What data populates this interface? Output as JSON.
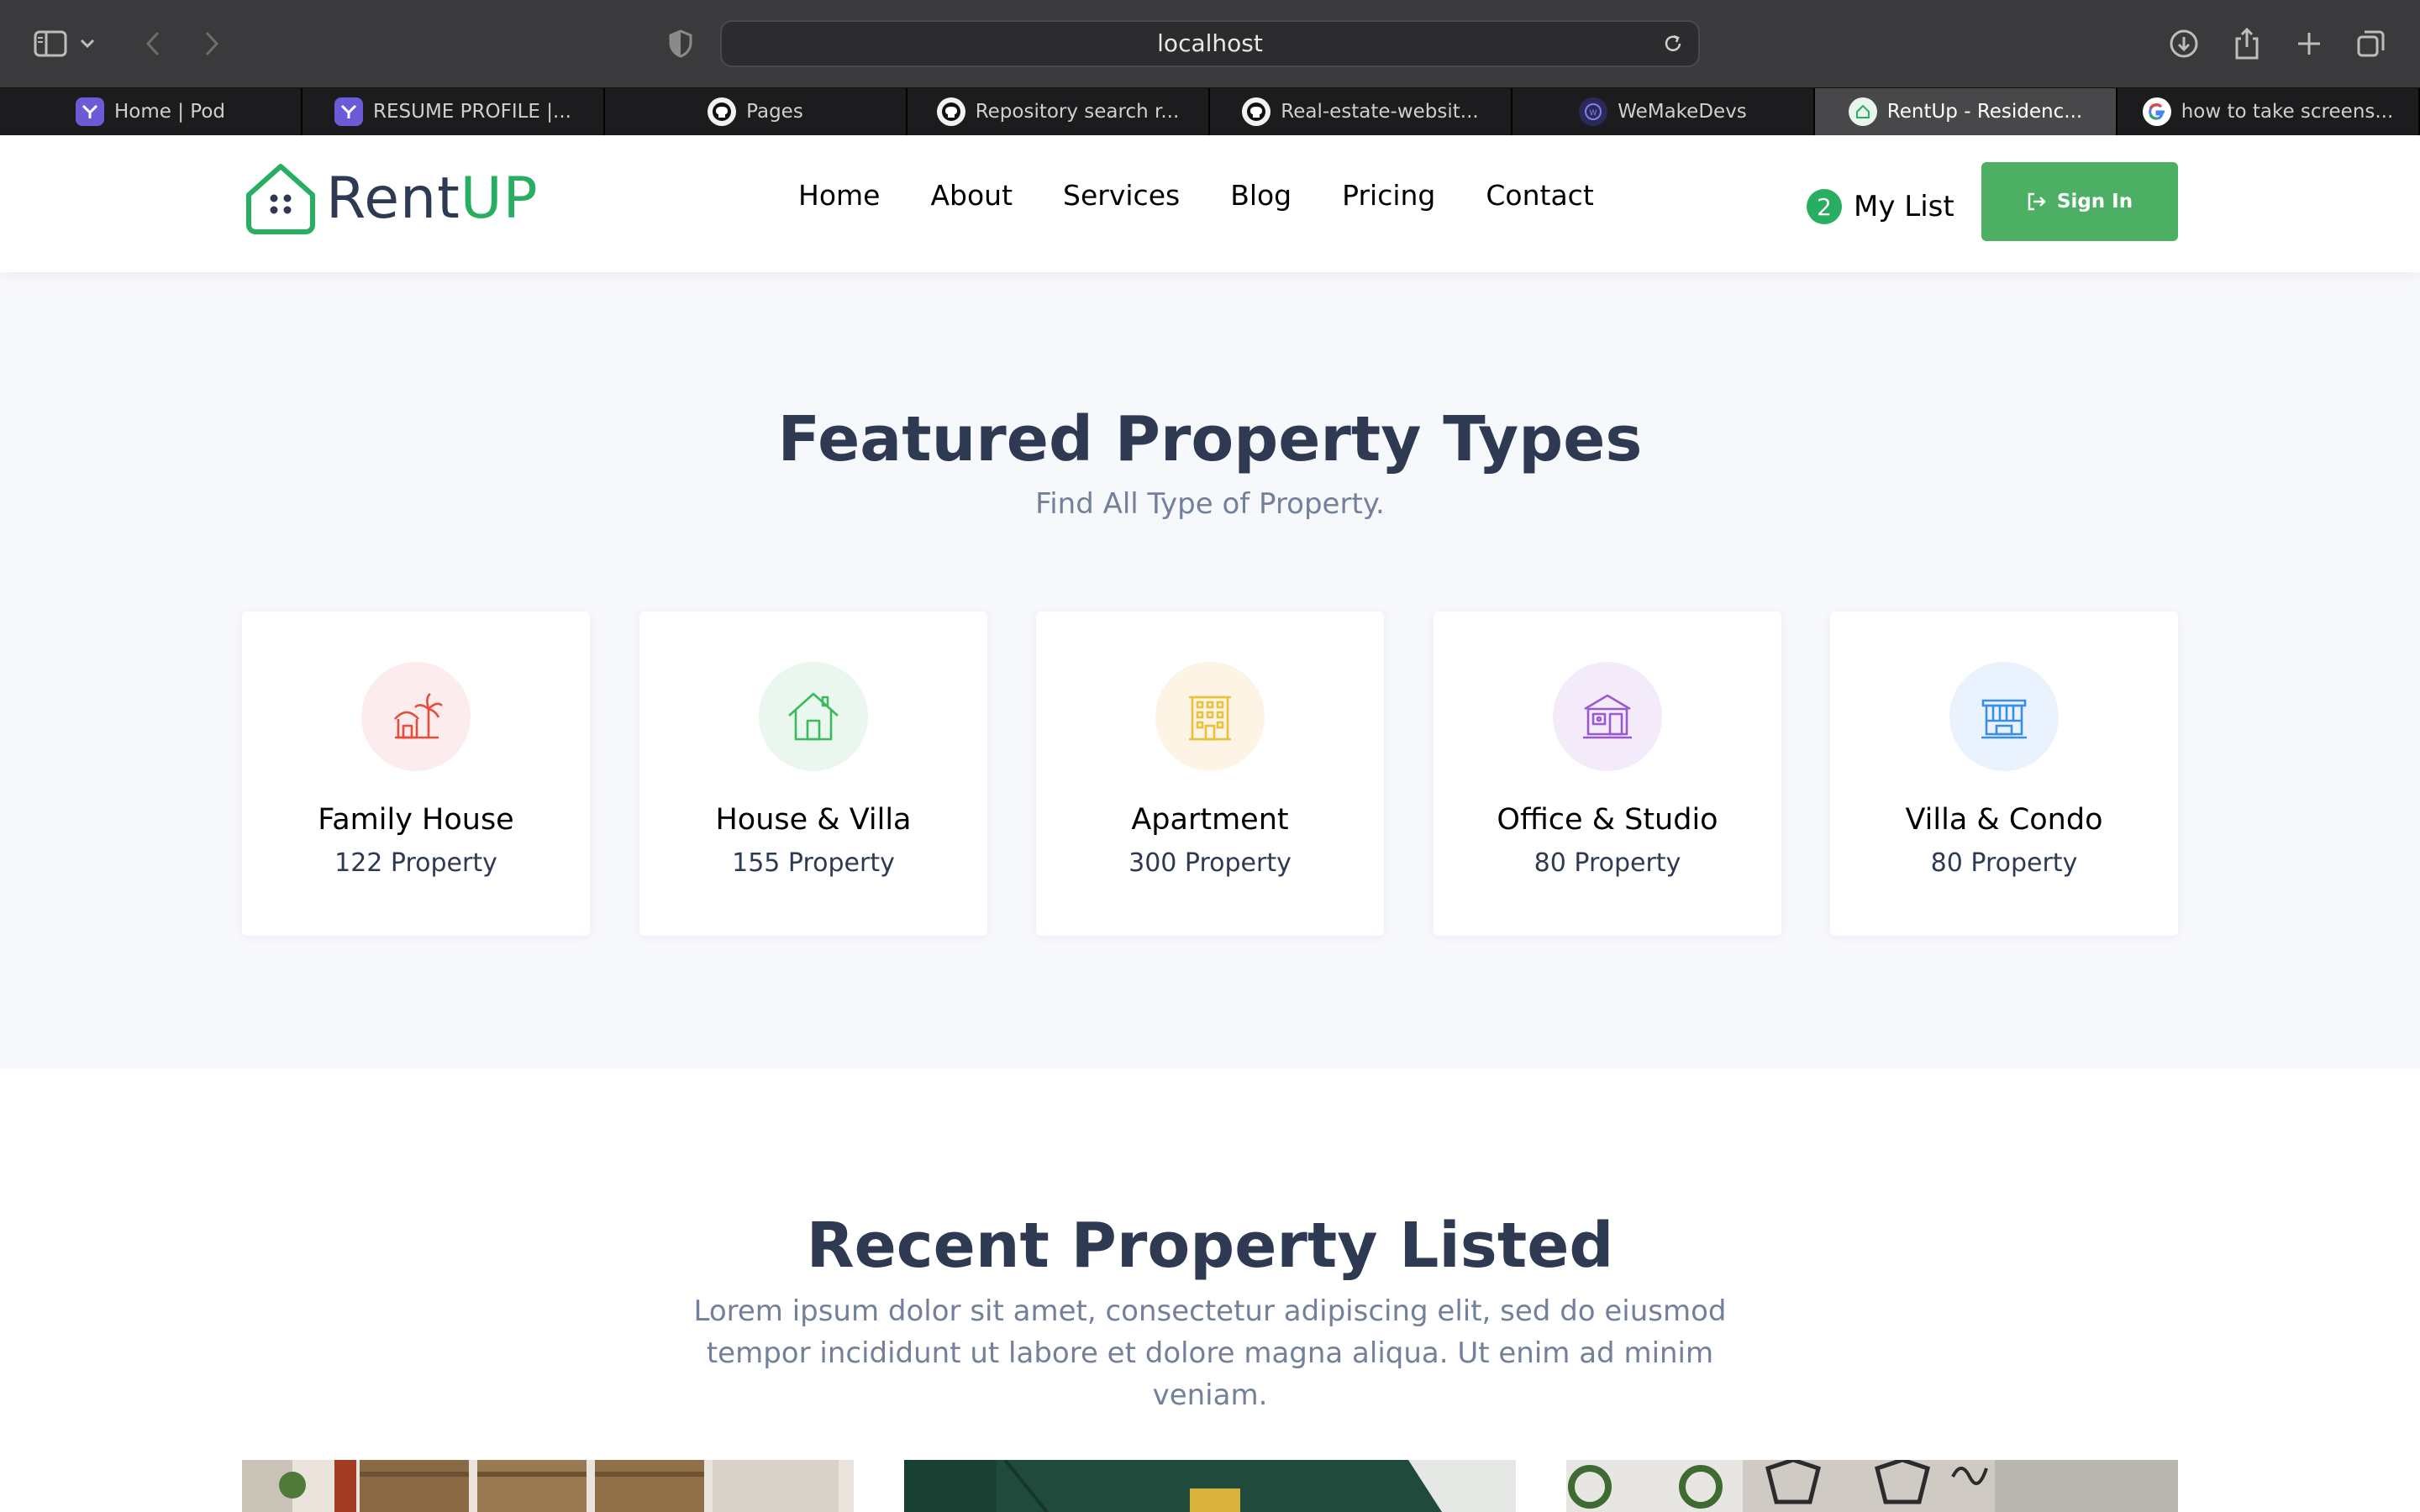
{
  "browser": {
    "url": "localhost",
    "tabs": [
      {
        "title": "Home | Pod",
        "favicon": "pod-icon"
      },
      {
        "title": "RESUME PROFILE |...",
        "favicon": "pod-icon"
      },
      {
        "title": "Pages",
        "favicon": "github-icon"
      },
      {
        "title": "Repository search r...",
        "favicon": "github-icon"
      },
      {
        "title": "Real-estate-websit...",
        "favicon": "github-icon"
      },
      {
        "title": "WeMakeDevs",
        "favicon": "wemakedevs-icon"
      },
      {
        "title": "RentUp - Residenc...",
        "favicon": "rentup-icon",
        "active": true
      },
      {
        "title": "how to take screens...",
        "favicon": "google-icon"
      }
    ]
  },
  "header": {
    "logo_rent": "Rent",
    "logo_up": "UP",
    "nav": [
      "Home",
      "About",
      "Services",
      "Blog",
      "Pricing",
      "Contact"
    ],
    "mylist_count": "2",
    "mylist_label": "My List",
    "signin_label": "Sign In"
  },
  "featured": {
    "title": "Featured Property Types",
    "subtitle": "Find All Type of Property.",
    "cards": [
      {
        "name": "Family House",
        "count": "122 Property",
        "icon": "beach-hut-icon",
        "color": "#e74c3c",
        "bg": "#fdeced"
      },
      {
        "name": "House & Villa",
        "count": "155 Property",
        "icon": "house-icon",
        "color": "#3cb95f",
        "bg": "#e9f7ee"
      },
      {
        "name": "Apartment",
        "count": "300 Property",
        "icon": "apartment-building-icon",
        "color": "#e8c23a",
        "bg": "#fdf4e5"
      },
      {
        "name": "Office & Studio",
        "count": "80 Property",
        "icon": "office-icon",
        "color": "#9b59d0",
        "bg": "#f3eafa"
      },
      {
        "name": "Villa & Condo",
        "count": "80 Property",
        "icon": "condo-icon",
        "color": "#3a8ee6",
        "bg": "#eaf3fd"
      }
    ]
  },
  "recent": {
    "title": "Recent Property Listed",
    "subtitle": "Lorem ipsum dolor sit amet, consectetur adipiscing elit, sed do eiusmod tempor incididunt ut labore et dolore magna aliqua. Ut enim ad minim veniam."
  },
  "colors": {
    "accent": "#27ae60",
    "button": "#4caf63",
    "heading": "#2d3a52",
    "muted": "#72809a"
  }
}
